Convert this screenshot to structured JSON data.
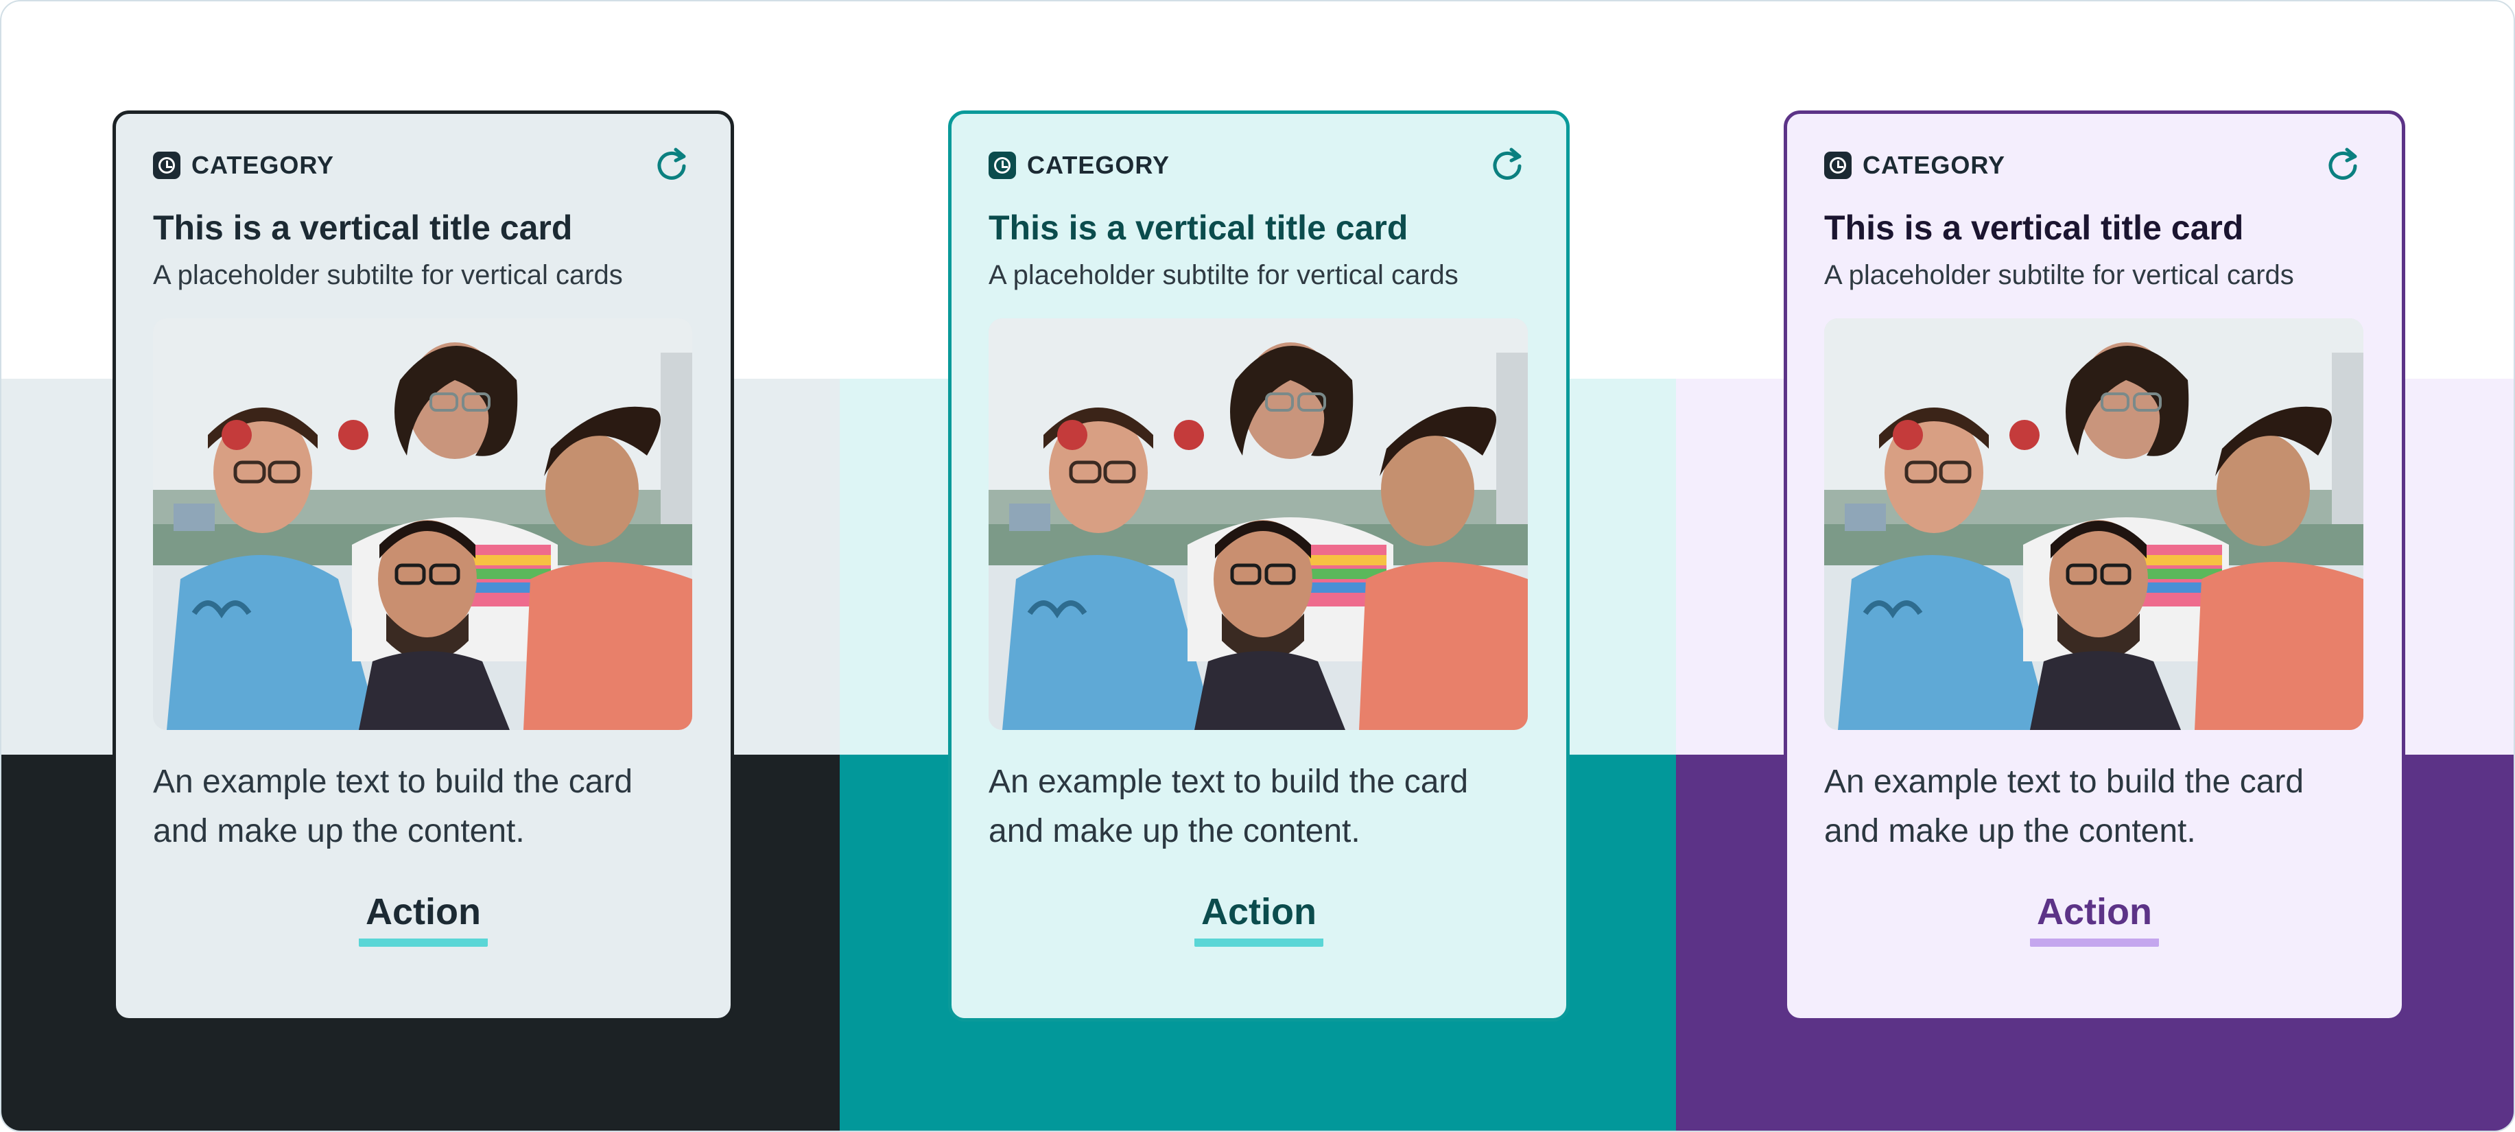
{
  "cards": [
    {
      "id": "neutral",
      "category": "CATEGORY",
      "title": "This is a vertical title card",
      "subtitle": "A placeholder subtilte for vertical cards",
      "body": "An example text to build the card and make up the content.",
      "action": "Action",
      "colors": {
        "band_light": "#e6edf0",
        "band_dark": "#1c2225",
        "card_bg": "#e6edf0",
        "card_border": "#1c2225",
        "title": "#1c2a33",
        "action_text": "#1c2a33",
        "action_underline": "#5ad6d6",
        "category_icon": "#1c2a33",
        "refresh_icon": "#0b8080"
      }
    },
    {
      "id": "teal",
      "category": "CATEGORY",
      "title": "This is a vertical title card",
      "subtitle": "A placeholder subtilte for vertical cards",
      "body": "An example text to build the card and make up the content.",
      "action": "Action",
      "colors": {
        "band_light": "#ddf5f5",
        "band_dark": "#02989a",
        "card_bg": "#ddf5f5",
        "card_border": "#0a9a9a",
        "title": "#0b4c4d",
        "action_text": "#0b4c4d",
        "action_underline": "#5ad6d6",
        "category_icon": "#0b4c4d",
        "refresh_icon": "#0b8080"
      }
    },
    {
      "id": "purple",
      "category": "CATEGORY",
      "title": "This is a vertical title card",
      "subtitle": "A placeholder subtilte for vertical cards",
      "body": "An example text to build the card and make up the content.",
      "action": "Action",
      "colors": {
        "band_light": "#f4eefd",
        "band_dark": "#5c3387",
        "card_bg": "#f4eefd",
        "card_border": "#5c3387",
        "title": "#1b1530",
        "action_text": "#5c3387",
        "action_underline": "#c4a6ee",
        "category_icon": "#1c2a33",
        "refresh_icon": "#0b8080"
      }
    }
  ],
  "icons": {
    "category": "clock-badge-icon",
    "refresh": "refresh-icon"
  }
}
